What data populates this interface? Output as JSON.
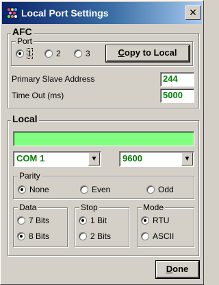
{
  "window": {
    "title": "Local Port Settings",
    "close_glyph": "✕"
  },
  "afc": {
    "legend": "AFC",
    "port": {
      "legend": "Port",
      "options": [
        {
          "label": "1",
          "selected": true
        },
        {
          "label": "2",
          "selected": false
        },
        {
          "label": "3",
          "selected": false
        }
      ],
      "copy_button": {
        "accel": "C",
        "rest": "opy to Local"
      }
    },
    "primary_slave_address": {
      "label": "Primary Slave Address",
      "value": "244"
    },
    "time_out": {
      "label": "Time Out (ms)",
      "value": "5000"
    }
  },
  "local": {
    "legend": "Local",
    "status_color": "#80ff80",
    "com_port": {
      "value": "COM 1"
    },
    "baud_rate": {
      "value": "9600"
    },
    "parity": {
      "legend": "Parity",
      "options": [
        {
          "label": "None",
          "selected": true
        },
        {
          "label": "Even",
          "selected": false
        },
        {
          "label": "Odd",
          "selected": false
        }
      ]
    },
    "data": {
      "legend": "Data",
      "options": [
        {
          "label": "7 Bits",
          "selected": false
        },
        {
          "label": "8 Bits",
          "selected": true
        }
      ]
    },
    "stop": {
      "legend": "Stop",
      "options": [
        {
          "label": "1 Bit",
          "selected": true
        },
        {
          "label": "2 Bits",
          "selected": false
        }
      ]
    },
    "mode": {
      "legend": "Mode",
      "options": [
        {
          "label": "RTU",
          "selected": true
        },
        {
          "label": "ASCII",
          "selected": false
        }
      ]
    }
  },
  "done_button": {
    "accel": "D",
    "rest": "one"
  },
  "colors": {
    "title_bar": "#0a246a",
    "field_text": "#008000",
    "dialog_face": "#d4d0c8"
  }
}
